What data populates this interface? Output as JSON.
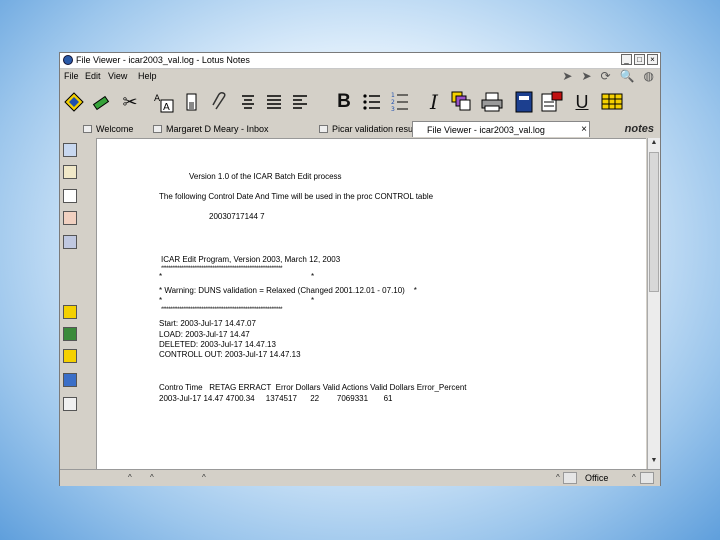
{
  "window": {
    "title": "File Viewer - icar2003_val.log - Lotus Notes",
    "controls": [
      "_",
      "□",
      "×"
    ]
  },
  "menu": [
    "File",
    "Edit",
    "View",
    "Help"
  ],
  "tabs": [
    {
      "label": "Welcome"
    },
    {
      "label": "Margaret D Meary - Inbox"
    },
    {
      "label": "Picar validation result"
    },
    {
      "label": "File Viewer - icar2003_val.log",
      "active": true
    }
  ],
  "brand": "notes",
  "document": {
    "lines": [
      "Version 1.0 of the ICAR Batch Edit process",
      "The following Control Date And Time will be used in the proc CONTROL table",
      "20030717144 7",
      "ICAR Edit Program, Version 2003, March 12, 2003",
      "*                                                                   *",
      "* Warning: DUNS validation = Relaxed (Changed 2001.12.01 - 07.10)    *",
      "*                                                                   *",
      "Start: 2003-Jul-17 14.47.07",
      "LOAD: 2003-Jul-17 14.47",
      "DELETED: 2003-Jul-17 14.47.13",
      "CONTROLL OUT: 2003-Jul-17 14.47.13",
      "Contro Time   RETAG ERRACT  Error Dollars Valid Actions Valid Dollars Error_Percent",
      "2003-Jul-17 14.47 4700.34     1374517      22        7069331       61"
    ],
    "separator": "******************************************************************"
  },
  "status": {
    "location": "Office"
  },
  "colors": {
    "window_bg": "#d4d0c8",
    "desktop_edge": "#5f9fdc",
    "doc_bg": "#ffffff"
  }
}
